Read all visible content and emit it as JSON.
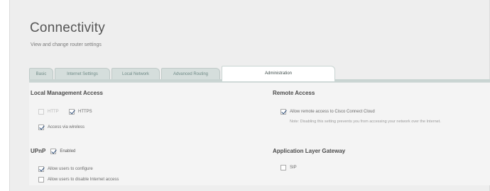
{
  "page": {
    "title": "Connectivity",
    "subtitle": "View and change router settings"
  },
  "tabs": [
    {
      "label": "Basic",
      "active": false
    },
    {
      "label": "Internet Settings",
      "active": false
    },
    {
      "label": "Local Network",
      "active": false
    },
    {
      "label": "Advanced Routing",
      "active": false
    },
    {
      "label": "Administration",
      "active": true
    }
  ],
  "local_management": {
    "heading": "Local Management Access",
    "http": {
      "label": "HTTP",
      "checked": false,
      "disabled": true
    },
    "https": {
      "label": "HTTPS",
      "checked": true,
      "disabled": false
    },
    "wireless": {
      "label": "Access via wireless",
      "checked": true,
      "disabled": false
    }
  },
  "remote_access": {
    "heading": "Remote Access",
    "allow_cloud": {
      "label": "Allow remote access to Cisco Connect Cloud",
      "checked": true
    },
    "note": "Note: Disabling this setting prevents you from accessing your network over the Internet."
  },
  "upnp": {
    "heading": "UPnP",
    "enabled": {
      "label": "Enabled",
      "checked": true
    },
    "allow_configure": {
      "label": "Allow users to configure",
      "checked": true
    },
    "allow_disable_internet": {
      "label": "Allow users to disable Internet access",
      "checked": false
    }
  },
  "alg": {
    "heading": "Application Layer Gateway",
    "sip": {
      "label": "SIP",
      "checked": false
    }
  },
  "colors": {
    "accent": "#2f4f7a",
    "tab_inactive": "#d5dedc",
    "background": "#eeeeee"
  }
}
